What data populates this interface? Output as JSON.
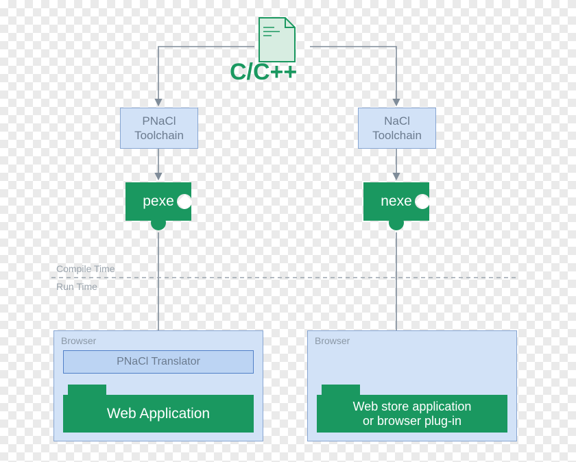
{
  "source": {
    "label": "C/C++",
    "icon": "source-file-icon"
  },
  "left": {
    "toolchain": "PNaCl\nToolchain",
    "artifact": "pexe",
    "browser_label": "Browser",
    "translator": "PNaCl Translator",
    "app": "Web Application"
  },
  "right": {
    "toolchain": "NaCl\nToolchain",
    "artifact": "nexe",
    "browser_label": "Browser",
    "app": "Web store application\nor browser plug-in"
  },
  "phases": {
    "compile": "Compile Time",
    "run": "Run Time"
  },
  "colors": {
    "green": "#1a9860",
    "box_fill": "#d2e2f7",
    "box_stroke": "#87a5d1"
  }
}
